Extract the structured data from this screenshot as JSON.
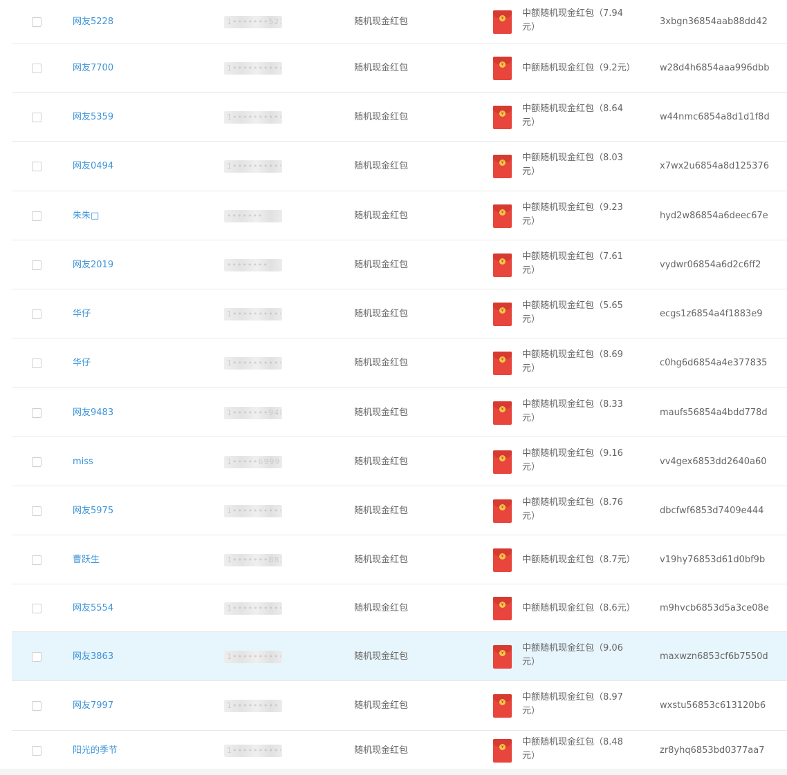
{
  "rows": [
    {
      "nickname": "网友5228",
      "phone": "1•••••••5228",
      "type": "随机现金红包",
      "prize": "中额随机现金红包（7.94元）",
      "code": "3xbgn36854aab88dd42",
      "highlight": false
    },
    {
      "nickname": "网友7700",
      "phone": "1•••••••••••",
      "type": "随机现金红包",
      "prize": "中额随机现金红包（9.2元）",
      "code": "w28d4h6854aaa996dbb",
      "highlight": false
    },
    {
      "nickname": "网友5359",
      "phone": "1••••••••••••",
      "type": "随机现金红包",
      "prize": "中额随机现金红包（8.64元）",
      "code": "w44nmc6854a8d1d1f8d",
      "highlight": false
    },
    {
      "nickname": "网友0494",
      "phone": "1•••••••••••",
      "type": "随机现金红包",
      "prize": "中额随机现金红包（8.03元）",
      "code": "x7wx2u6854a8d125376",
      "highlight": false
    },
    {
      "nickname": "朱朱□",
      "phone": "•••••••",
      "type": "随机现金红包",
      "prize": "中额随机现金红包（9.23元）",
      "code": "hyd2w86854a6deec67e",
      "highlight": false
    },
    {
      "nickname": "网友2019",
      "phone": "••••••••",
      "type": "随机现金红包",
      "prize": "中额随机现金红包（7.61元）",
      "code": "vydwr06854a6d2c6ff2",
      "highlight": false
    },
    {
      "nickname": "华仔",
      "phone": "1•••••••••••",
      "type": "随机现金红包",
      "prize": "中额随机现金红包（5.65元）",
      "code": "ecgs1z6854a4f1883e9",
      "highlight": false
    },
    {
      "nickname": "华仔",
      "phone": "1•••••••••••",
      "type": "随机现金红包",
      "prize": "中额随机现金红包（8.69元）",
      "code": "c0hg6d6854a4e377835",
      "highlight": false
    },
    {
      "nickname": "网友9483",
      "phone": "1•••••••9483",
      "type": "随机现金红包",
      "prize": "中额随机现金红包（8.33元）",
      "code": "maufs56854a4bdd778d",
      "highlight": false
    },
    {
      "nickname": "miss",
      "phone": "1•••••69999",
      "type": "随机现金红包",
      "prize": "中额随机现金红包（9.16元）",
      "code": "vv4gex6853dd2640a60",
      "highlight": false
    },
    {
      "nickname": "网友5975",
      "phone": "1•••••••••••",
      "type": "随机现金红包",
      "prize": "中额随机现金红包（8.76元）",
      "code": "dbcfwf6853d7409e444",
      "highlight": false
    },
    {
      "nickname": "曹跃生",
      "phone": "1•••••••8824",
      "type": "随机现金红包",
      "prize": "中额随机现金红包（8.7元）",
      "code": "v19hy76853d61d0bf9b",
      "highlight": false
    },
    {
      "nickname": "网友5554",
      "phone": "1•••••••••••",
      "type": "随机现金红包",
      "prize": "中额随机现金红包（8.6元）",
      "code": "m9hvcb6853d5a3ce08e",
      "highlight": false
    },
    {
      "nickname": "网友3863",
      "phone": "1•••••••••••",
      "type": "随机现金红包",
      "prize": "中额随机现金红包（9.06元）",
      "code": "maxwzn6853cf6b7550d",
      "highlight": true
    },
    {
      "nickname": "网友7997",
      "phone": "1•••••••••",
      "type": "随机现金红包",
      "prize": "中额随机现金红包（8.97元）",
      "code": "wxstu56853c613120b6",
      "highlight": false
    },
    {
      "nickname": "阳光的季节",
      "phone": "1•••••••••••",
      "type": "随机现金红包",
      "prize": "中额随机现金红包（8.48元）",
      "code": "zr8yhq6853bd0377aa7",
      "highlight": false
    }
  ]
}
